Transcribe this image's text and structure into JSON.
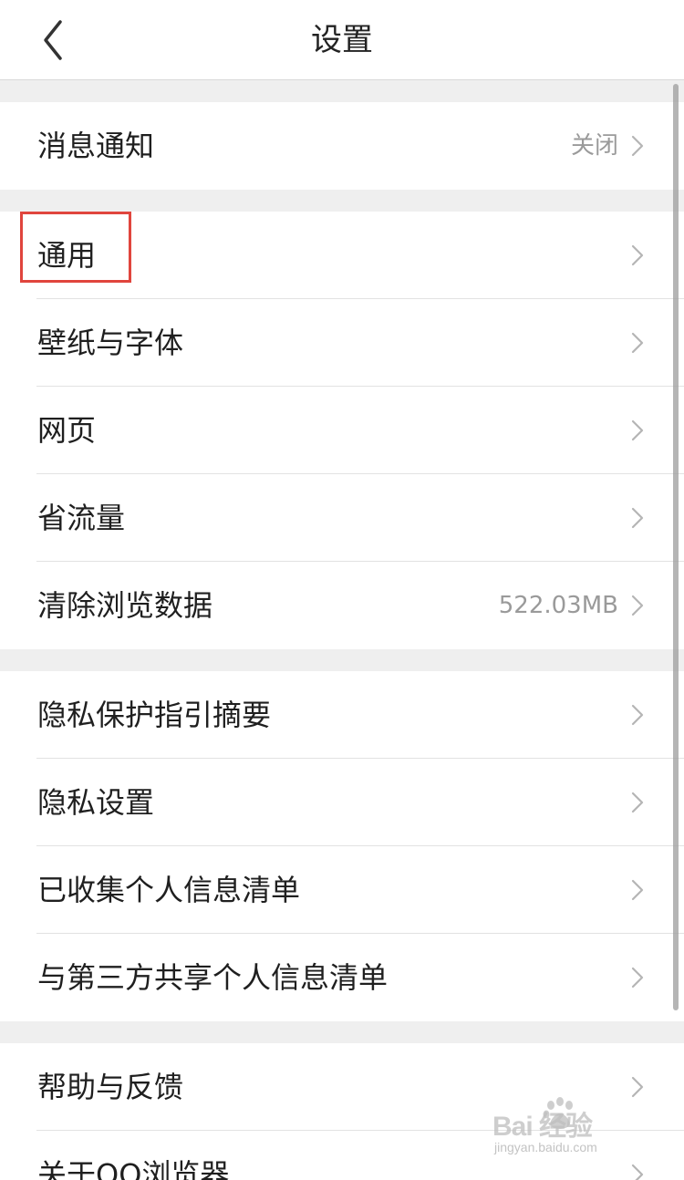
{
  "header": {
    "title": "设置",
    "back_icon": "chevron-left-icon"
  },
  "groups": [
    {
      "items": [
        {
          "label": "消息通知",
          "value": "关闭"
        }
      ]
    },
    {
      "items": [
        {
          "label": "通用",
          "value": ""
        },
        {
          "label": "壁纸与字体",
          "value": ""
        },
        {
          "label": "网页",
          "value": ""
        },
        {
          "label": "省流量",
          "value": ""
        },
        {
          "label": "清除浏览数据",
          "value": "522.03MB"
        }
      ]
    },
    {
      "items": [
        {
          "label": "隐私保护指引摘要",
          "value": ""
        },
        {
          "label": "隐私设置",
          "value": ""
        },
        {
          "label": "已收集个人信息清单",
          "value": ""
        },
        {
          "label": "与第三方共享个人信息清单",
          "value": ""
        }
      ]
    },
    {
      "items": [
        {
          "label": "帮助与反馈",
          "value": ""
        },
        {
          "label": "关于QQ浏览器",
          "value": ""
        }
      ]
    }
  ],
  "watermark": {
    "main": "Bai  经验",
    "sub": "jingyan.baidu.com"
  },
  "colors": {
    "highlight": "#e0453d",
    "background": "#efefef",
    "text": "#1f1f1f",
    "secondary_text": "#9a9a9a"
  }
}
